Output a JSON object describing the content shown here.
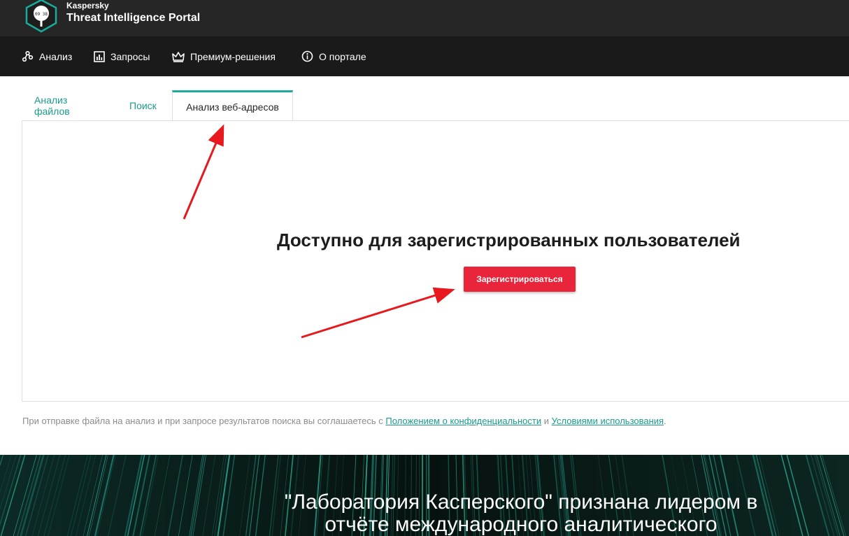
{
  "brand": {
    "company": "Kaspersky",
    "product": "Threat Intelligence Portal",
    "logo_text": "09 38"
  },
  "nav": {
    "items": [
      {
        "label": "Анализ",
        "icon": "graph-icon"
      },
      {
        "label": "Запросы",
        "icon": "chart-icon"
      },
      {
        "label": "Премиум-решения",
        "icon": "crown-icon"
      },
      {
        "label": "О портале",
        "icon": "info-icon"
      }
    ]
  },
  "tabs": [
    {
      "label": "Анализ файлов",
      "active": false
    },
    {
      "label": "Поиск",
      "active": false
    },
    {
      "label": "Анализ веб-адресов",
      "active": true
    }
  ],
  "panel": {
    "title": "Доступно для зарегистрированных пользователей",
    "register_button": "Зарегистрироваться"
  },
  "footnote": {
    "prefix": "При отправке файла на анализ и при запросе результатов поиска вы соглашаетесь с ",
    "privacy_link": "Положением о конфиденциальности",
    "and": " и ",
    "terms_link": "Условиями использования",
    "suffix": "."
  },
  "banner": {
    "line1": "\"Лаборатория Касперского\" признана лидером в",
    "line2": "отчёте международного аналитического"
  },
  "colors": {
    "accent": "#1aab9b",
    "button": "#e8253a",
    "annotation_arrow": "#e8191e"
  }
}
